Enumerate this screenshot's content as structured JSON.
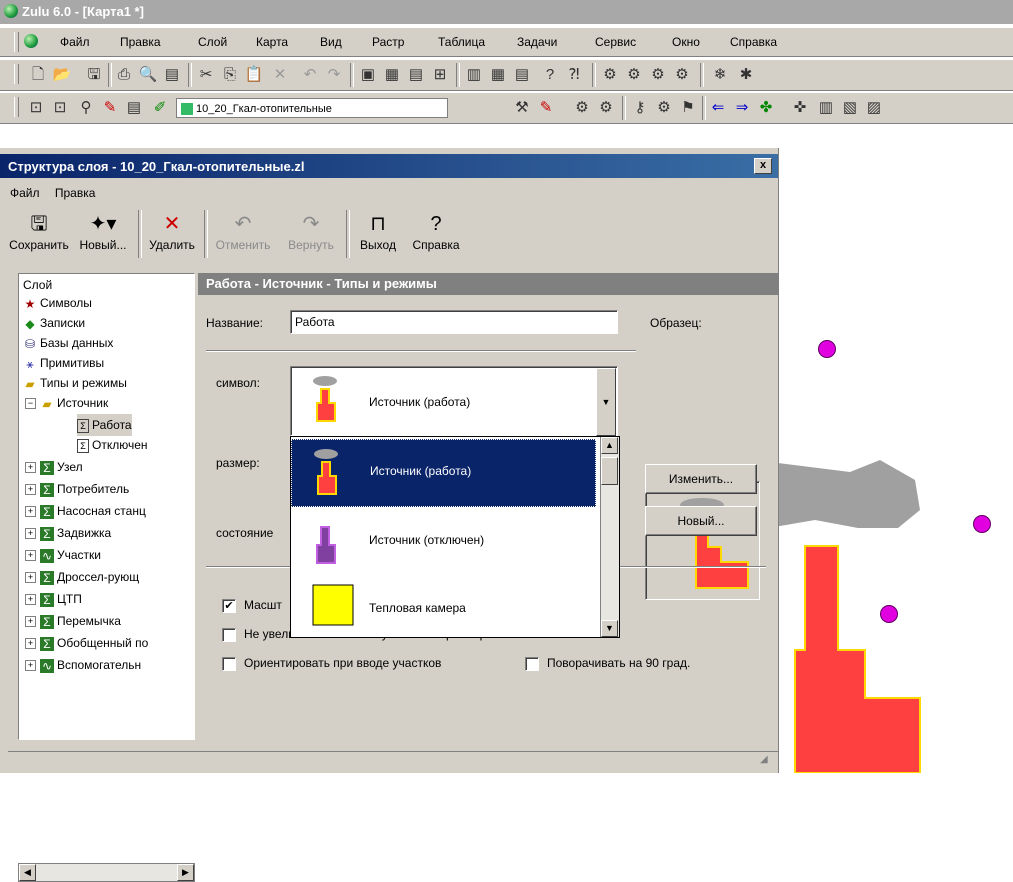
{
  "app": {
    "title": "Zulu 6.0 - [Карта1 *]"
  },
  "menubar": {
    "items": [
      "Файл",
      "Правка",
      "Слой",
      "Карта",
      "Вид",
      "Растр",
      "Таблица",
      "Задачи",
      "Сервис",
      "Окно",
      "Справка"
    ]
  },
  "layer_combo": {
    "value": "10_20_Гкал-отопительные"
  },
  "dialog": {
    "title": "Структура слоя - 10_20_Гкал-отопительные.zl",
    "close": "x",
    "menu": [
      "Файл",
      "Правка"
    ],
    "toolbar": {
      "save": "Сохранить",
      "new": "Новый...",
      "delete": "Удалить",
      "undo": "Отменить",
      "redo": "Вернуть",
      "exit": "Выход",
      "help": "Справка"
    },
    "tree": {
      "root": "Слой",
      "items": [
        "Символы",
        "Записки",
        "Базы данных",
        "Примитивы",
        "Типы и режимы",
        "Источник",
        "Работа",
        "Отключен",
        "Узел",
        "Потребитель",
        "Насосная станц",
        "Задвижка",
        "Участки",
        "Дроссел-рующ",
        "ЦТП",
        "Перемычка",
        "Обобщенный по",
        "Вспомогательн"
      ]
    },
    "panel": {
      "header": "Работа - Источник - Типы и режимы",
      "name_label": "Название:",
      "name_value": "Работа",
      "sample_label": "Образец:",
      "symbol_label": "символ:",
      "symbol_value": "Источник (работа)",
      "size_label": "размер:",
      "state_label": "состояние",
      "change_button": "Изменить...",
      "new_button": "Новый...",
      "checkbox_scale": "Масшт",
      "checkbox_no_bigger": "Не увеличивать больше указанного размера",
      "checkbox_orient": "Ориентировать при вводе участков",
      "checkbox_rotate": "Поворачивать на 90 град."
    },
    "dropdown": {
      "options": [
        "Источник (работа)",
        "Источник (отключен)",
        "Тепловая камера"
      ]
    }
  },
  "colors": {
    "selection": "#0a246a",
    "source_red": "#ff4040",
    "source_yellow": "#ffd800",
    "node_magenta": "#e000e0",
    "map_gray": "#a0a0a0"
  }
}
